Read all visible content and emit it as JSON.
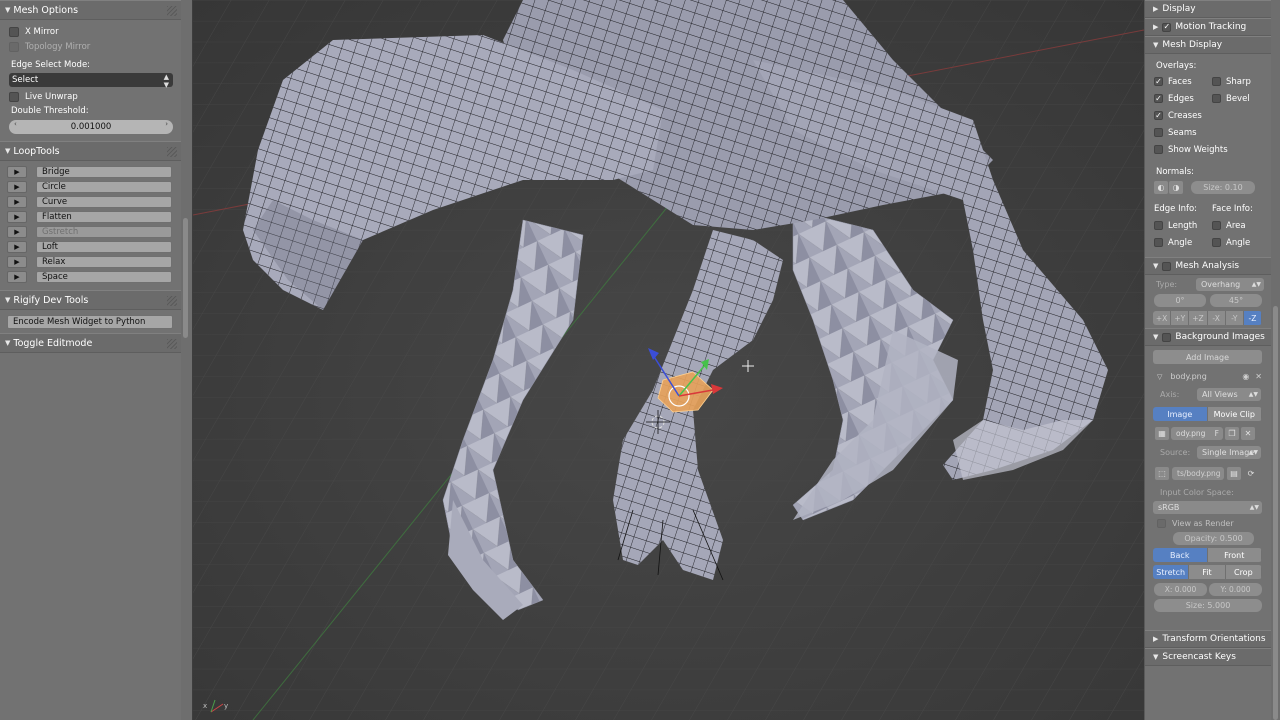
{
  "left_panel": {
    "mesh_options": {
      "title": "Mesh Options",
      "x_mirror": "X Mirror",
      "topology_mirror": "Topology Mirror",
      "edge_select_mode_label": "Edge Select Mode:",
      "edge_select_mode_value": "Select",
      "live_unwrap": "Live Unwrap",
      "double_threshold_label": "Double Threshold:",
      "double_threshold_value": "0.001000"
    },
    "looptools": {
      "title": "LoopTools",
      "items": [
        "Bridge",
        "Circle",
        "Curve",
        "Flatten",
        "Gstretch",
        "Loft",
        "Relax",
        "Space"
      ]
    },
    "rigify": {
      "title": "Rigify Dev Tools",
      "encode_button": "Encode Mesh Widget to Python"
    },
    "toggle_editmode": {
      "title": "Toggle Editmode"
    }
  },
  "right_panel": {
    "display": "Display",
    "motion_tracking": "Motion Tracking",
    "mesh_display": {
      "title": "Mesh Display",
      "overlays_label": "Overlays:",
      "faces": "Faces",
      "sharp": "Sharp",
      "edges": "Edges",
      "bevel": "Bevel",
      "creases": "Creases",
      "seams": "Seams",
      "show_weights": "Show Weights",
      "normals_label": "Normals:",
      "normals_size": "Size: 0.10",
      "edge_info_label": "Edge Info:",
      "face_info_label": "Face Info:",
      "length": "Length",
      "area": "Area",
      "angle_edge": "Angle",
      "angle_face": "Angle"
    },
    "mesh_analysis": {
      "title": "Mesh Analysis",
      "type_label": "Type:",
      "type_value": "Overhang",
      "min": "0°",
      "max": "45°",
      "axes": [
        "+X",
        "+Y",
        "+Z",
        "-X",
        "-Y",
        "-Z"
      ]
    },
    "background_images": {
      "title": "Background Images",
      "add_image": "Add Image",
      "image_name": "body.png",
      "axis_label": "Axis:",
      "axis_value": "All Views",
      "tab_image": "Image",
      "tab_movie": "Movie Clip",
      "file_field": "ody.png",
      "file_flag": "F",
      "source_label": "Source:",
      "source_value": "Single Image",
      "path_value": "ts/body.png",
      "input_color_label": "Input Color Space:",
      "input_color_value": "sRGB",
      "view_as_render": "View as Render",
      "opacity": "Opacity: 0.500",
      "back": "Back",
      "front": "Front",
      "stretch": "Stretch",
      "fit": "Fit",
      "crop": "Crop",
      "x_offset": "X: 0.000",
      "y_offset": "Y: 0.000",
      "size": "Size: 5.000"
    },
    "transform_orientations": "Transform Orientations",
    "screencast_keys": "Screencast Keys"
  },
  "viewport": {
    "axis_x": "x",
    "axis_y": "y"
  },
  "colors": {
    "accent_blue": "#5680c2",
    "selection_orange": "#e8a25a",
    "mesh_face": "#9a9cad",
    "mesh_face_light": "#c3c5d2",
    "wire": "#222222"
  }
}
